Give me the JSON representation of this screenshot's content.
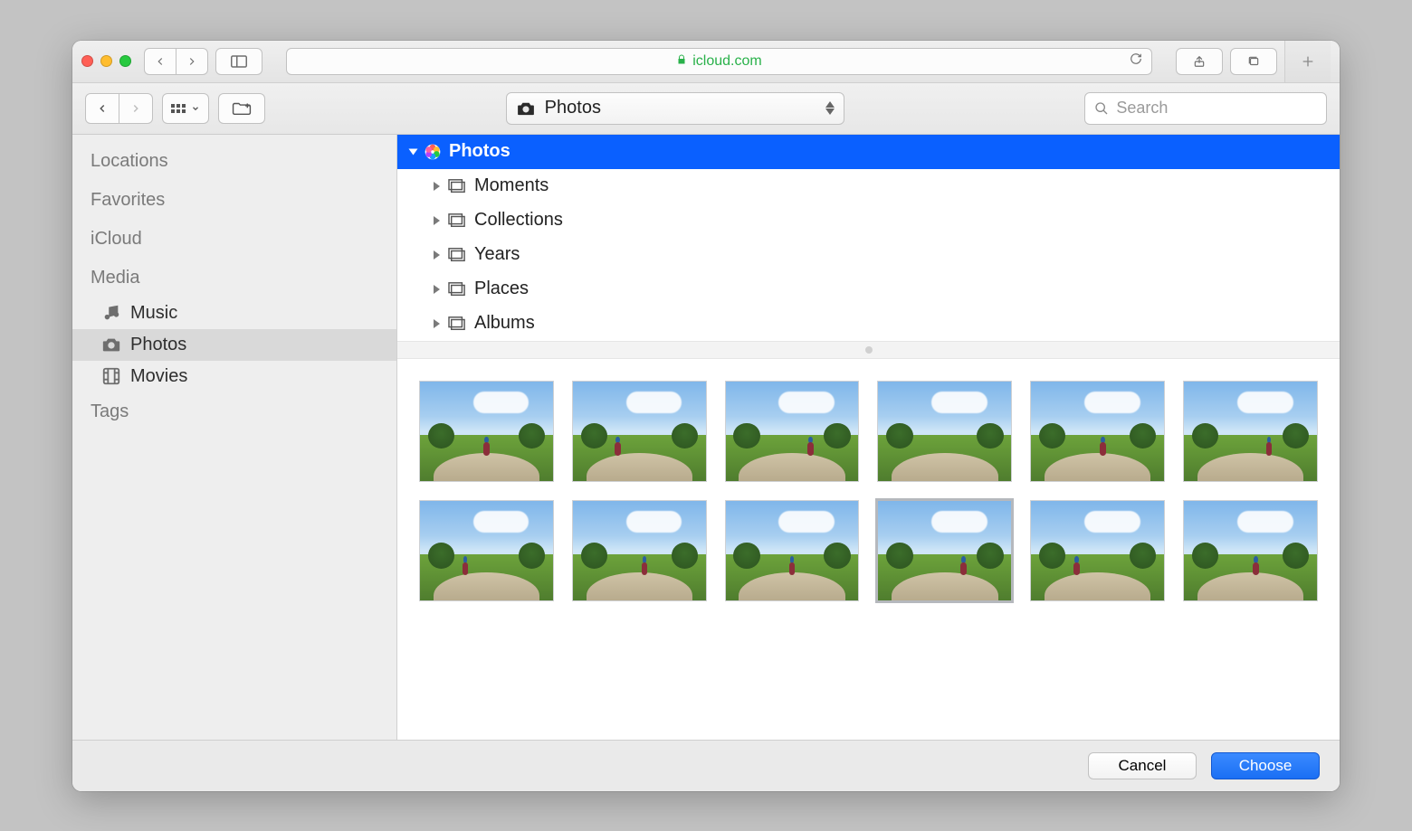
{
  "browser": {
    "url_host": "icloud.com"
  },
  "picker": {
    "location_label": "Photos",
    "search_placeholder": "Search",
    "sidebar": {
      "sections": {
        "locations": "Locations",
        "favorites": "Favorites",
        "icloud": "iCloud",
        "media": "Media",
        "tags": "Tags"
      },
      "media_items": [
        {
          "label": "Music",
          "selected": false,
          "icon": "music-icon"
        },
        {
          "label": "Photos",
          "selected": true,
          "icon": "camera-icon"
        },
        {
          "label": "Movies",
          "selected": false,
          "icon": "film-icon"
        }
      ]
    },
    "tree": {
      "root": "Photos",
      "children": [
        "Moments",
        "Collections",
        "Years",
        "Places",
        "Albums"
      ]
    },
    "thumbnails": [
      {
        "selected": false
      },
      {
        "selected": false
      },
      {
        "selected": false
      },
      {
        "selected": false
      },
      {
        "selected": false
      },
      {
        "selected": false
      },
      {
        "selected": false
      },
      {
        "selected": false
      },
      {
        "selected": false
      },
      {
        "selected": true
      },
      {
        "selected": false
      },
      {
        "selected": false
      }
    ],
    "footer": {
      "cancel": "Cancel",
      "choose": "Choose"
    }
  }
}
